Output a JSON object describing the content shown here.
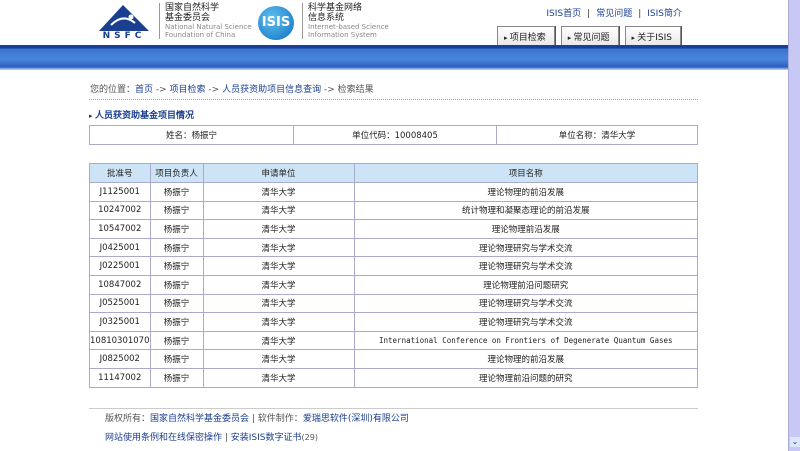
{
  "header": {
    "nsfc_logo_text": "NSFC",
    "org_cn_1": "国家自然科学",
    "org_cn_2": "基金委员会",
    "org_en_1": "National Natural Science",
    "org_en_2": "Foundation of China",
    "isis_logo_text": "ISIS",
    "sys_cn_1": "科学基金网络",
    "sys_cn_2": "信息系统",
    "sys_en_1": "Internet-based Science",
    "sys_en_2": "Information System"
  },
  "top_links": [
    "ISIS首页",
    "常见问题",
    "ISIS简介"
  ],
  "tabs": [
    "项目检索",
    "常见问题",
    "关于ISIS"
  ],
  "breadcrumb": {
    "prefix": "您的位置：",
    "items": [
      "首页",
      "项目检索",
      "人员获资助项目信息查询"
    ],
    "sep": " -> ",
    "current": "检索结果"
  },
  "section_title": "人员获资助基金项目情况",
  "info": {
    "name": "姓名：杨振宁",
    "unit_code": "单位代码：10008405",
    "unit_name": "单位名称：清华大学"
  },
  "table": {
    "headers": [
      "批准号",
      "项目负责人",
      "申请单位",
      "项目名称"
    ],
    "rows": [
      [
        "J1125001",
        "杨振宁",
        "清华大学",
        "理论物理的前沿发展"
      ],
      [
        "10247002",
        "杨振宁",
        "清华大学",
        "统计物理和凝聚态理论的前沿发展"
      ],
      [
        "10547002",
        "杨振宁",
        "清华大学",
        "理论物理前沿发展"
      ],
      [
        "J0425001",
        "杨振宁",
        "清华大学",
        "理论物理研究与学术交流"
      ],
      [
        "J0225001",
        "杨振宁",
        "清华大学",
        "理论物理研究与学术交流"
      ],
      [
        "10847002",
        "杨振宁",
        "清华大学",
        "理论物理前沿问题研究"
      ],
      [
        "J0525001",
        "杨振宁",
        "清华大学",
        "理论物理研究与学术交流"
      ],
      [
        "J0325001",
        "杨振宁",
        "清华大学",
        "理论物理研究与学术交流"
      ],
      [
        "10810301070",
        "杨振宁",
        "清华大学",
        "International Conference on Frontiers of Degenerate Quantum Gases"
      ],
      [
        "J0825002",
        "杨振宁",
        "清华大学",
        "理论物理的前沿发展"
      ],
      [
        "11147002",
        "杨振宁",
        "清华大学",
        "理论物理前沿问题的研究"
      ]
    ]
  },
  "footer": {
    "copyright_label": "版权所有：",
    "copyright_org": "国家自然科学基金委员会",
    "sep": " | ",
    "software_label": "软件制作：",
    "software_org": "爱瑞思软件(深圳)有限公司",
    "terms": "网站使用条例和在线保密操作",
    "cert": "安装ISIS数字证书",
    "cert_count": "(29)"
  }
}
